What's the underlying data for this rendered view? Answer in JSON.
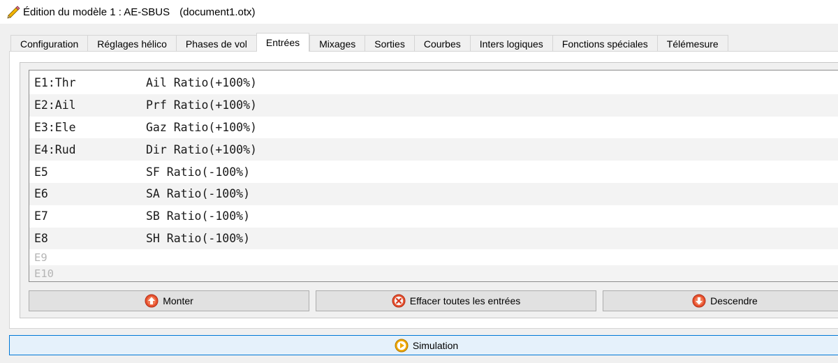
{
  "window": {
    "title": "Édition du modèle 1 : AE-SBUS",
    "document": "(document1.otx)"
  },
  "tabs": [
    {
      "label": "Configuration"
    },
    {
      "label": "Réglages hélico"
    },
    {
      "label": "Phases de vol"
    },
    {
      "label": "Entrées",
      "active": true
    },
    {
      "label": "Mixages"
    },
    {
      "label": "Sorties"
    },
    {
      "label": "Courbes"
    },
    {
      "label": "Inters logiques"
    },
    {
      "label": "Fonctions spéciales"
    },
    {
      "label": "Télémesure"
    }
  ],
  "inputs": [
    {
      "name": "E1:Thr",
      "value": "Ail Ratio(+100%)"
    },
    {
      "name": "E2:Ail",
      "value": "Prf Ratio(+100%)"
    },
    {
      "name": "E3:Ele",
      "value": "Gaz Ratio(+100%)"
    },
    {
      "name": "E4:Rud",
      "value": "Dir Ratio(+100%)"
    },
    {
      "name": "E5",
      "value": "SF Ratio(-100%)"
    },
    {
      "name": "E6",
      "value": "SA Ratio(-100%)"
    },
    {
      "name": "E7",
      "value": "SB Ratio(-100%)"
    },
    {
      "name": "E8",
      "value": "SH Ratio(-100%)"
    },
    {
      "name": "E9",
      "value": ""
    },
    {
      "name": "E10",
      "value": ""
    }
  ],
  "buttons": {
    "up": "Monter",
    "clear": "Effacer toutes les entrées",
    "down": "Descendre",
    "simulation": "Simulation"
  },
  "icons": {
    "title": "pencil-icon",
    "up": "arrow-up-circle-icon",
    "clear": "x-circle-icon",
    "down": "arrow-down-circle-icon",
    "simulation": "play-circle-icon"
  },
  "colors": {
    "accent": "#0078d7",
    "button_icon": "#e8502d",
    "play_icon": "#f0a800"
  }
}
